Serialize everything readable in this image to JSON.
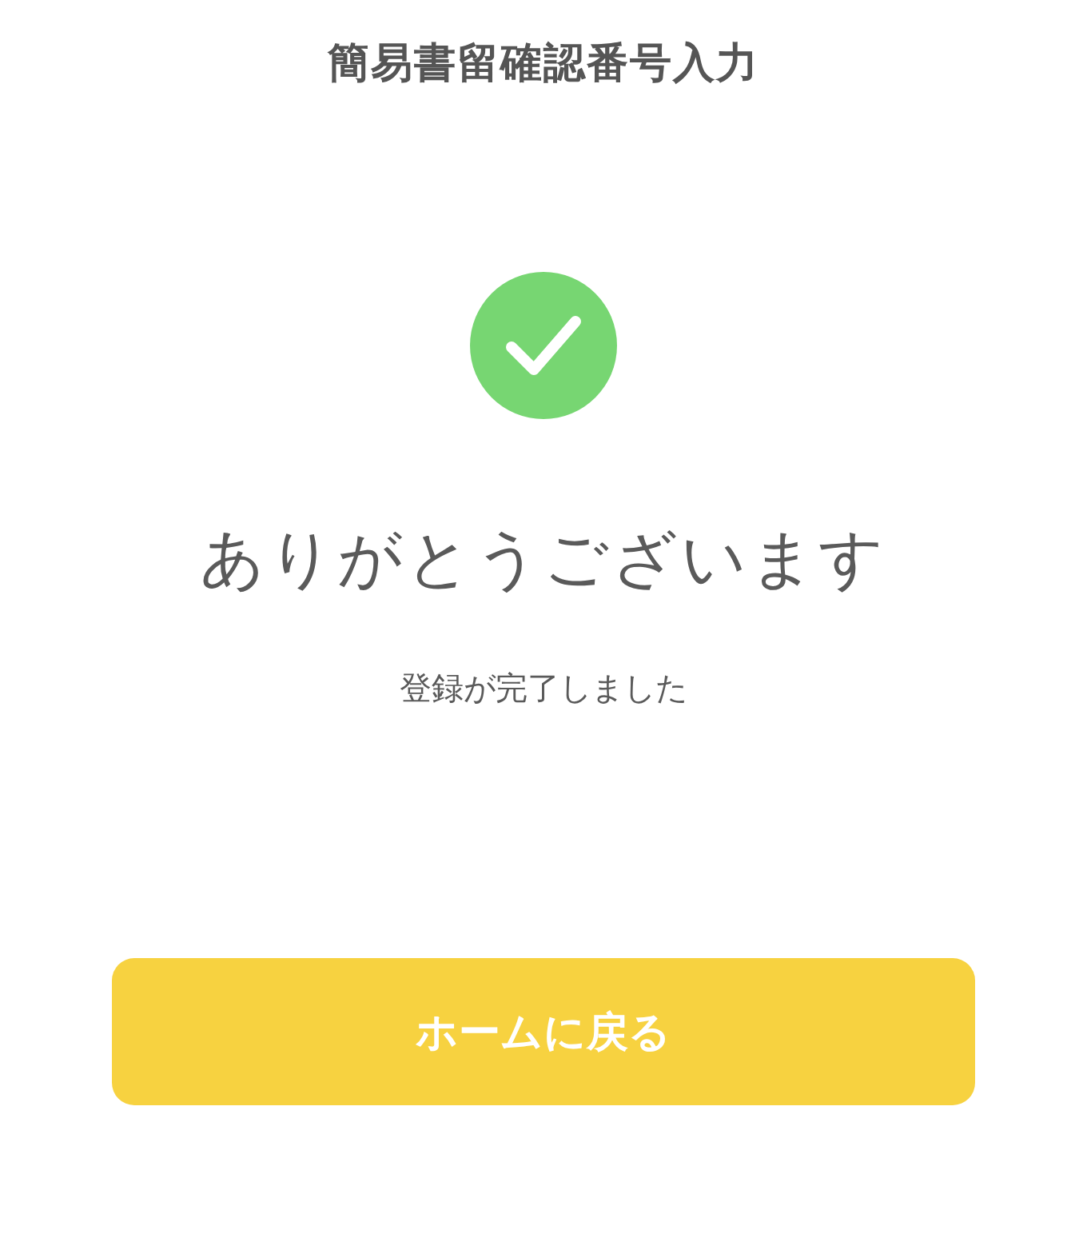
{
  "header": {
    "title": "簡易書留確認番号入力"
  },
  "result": {
    "success": true,
    "heading": "ありがとうございます",
    "message": "登録が完了しました"
  },
  "button": {
    "label": "ホームに戻る"
  }
}
